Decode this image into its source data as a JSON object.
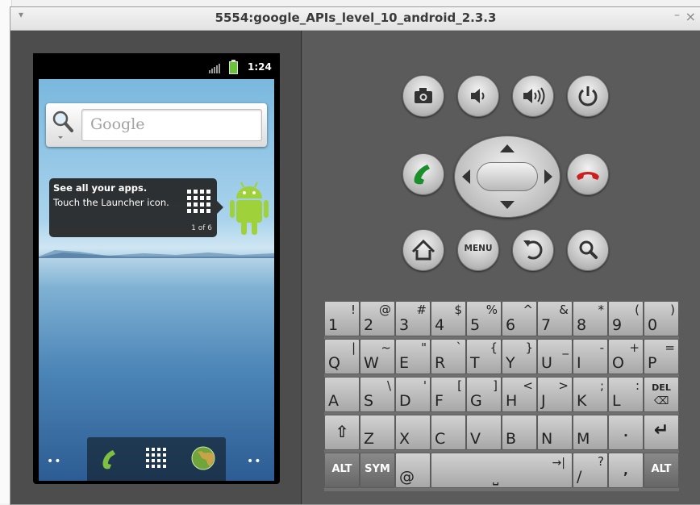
{
  "window": {
    "title": "5554:google_APIs_level_10_android_2.3.3",
    "menu_glyph": "▾",
    "minimize_glyph": "–",
    "close_glyph": "×"
  },
  "phone": {
    "status": {
      "time": "1:24"
    },
    "search": {
      "placeholder": "Google"
    },
    "tooltip": {
      "heading": "See all your apps.",
      "body": "Touch the Launcher icon.",
      "counter": "1 of 6"
    },
    "dock": {
      "left_dots": "••",
      "right_dots": "••"
    }
  },
  "controls": {
    "menu_label": "MENU"
  },
  "keyboard": {
    "rows": [
      [
        {
          "m": "1",
          "s": "!"
        },
        {
          "m": "2",
          "s": "@"
        },
        {
          "m": "3",
          "s": "#"
        },
        {
          "m": "4",
          "s": "$"
        },
        {
          "m": "5",
          "s": "%"
        },
        {
          "m": "6",
          "s": "^"
        },
        {
          "m": "7",
          "s": "&"
        },
        {
          "m": "8",
          "s": "*"
        },
        {
          "m": "9",
          "s": "("
        },
        {
          "m": "0",
          "s": ")"
        }
      ],
      [
        {
          "m": "Q",
          "s": "|"
        },
        {
          "m": "W",
          "s": "~"
        },
        {
          "m": "E",
          "s": "\""
        },
        {
          "m": "R",
          "s": "`"
        },
        {
          "m": "T",
          "s": "{"
        },
        {
          "m": "Y",
          "s": "}"
        },
        {
          "m": "U",
          "s": "_"
        },
        {
          "m": "I",
          "s": "-"
        },
        {
          "m": "O",
          "s": "+"
        },
        {
          "m": "P",
          "s": "="
        }
      ],
      [
        {
          "m": "A",
          "s": ""
        },
        {
          "m": "S",
          "s": "\\"
        },
        {
          "m": "D",
          "s": "'"
        },
        {
          "m": "F",
          "s": "["
        },
        {
          "m": "G",
          "s": "]"
        },
        {
          "m": "H",
          "s": "<"
        },
        {
          "m": "J",
          "s": ">"
        },
        {
          "m": "K",
          "s": ";"
        },
        {
          "m": "L",
          "s": ":"
        },
        {
          "m": "DEL",
          "s": ""
        }
      ],
      [
        {
          "m": "⇧",
          "s": ""
        },
        {
          "m": "Z",
          "s": ""
        },
        {
          "m": "X",
          "s": ""
        },
        {
          "m": "C",
          "s": ""
        },
        {
          "m": "V",
          "s": ""
        },
        {
          "m": "B",
          "s": ""
        },
        {
          "m": "N",
          "s": ""
        },
        {
          "m": "M",
          "s": ""
        },
        {
          "m": ".",
          "s": ""
        },
        {
          "m": "↵",
          "s": ""
        }
      ]
    ],
    "bottom": {
      "alt_left": "ALT",
      "sym": "SYM",
      "at": "@",
      "slash": "/",
      "slash_alt": "?",
      "comma": ",",
      "alt_right": "ALT",
      "space_glyph": "⎵",
      "tab_glyph": "→|"
    }
  }
}
